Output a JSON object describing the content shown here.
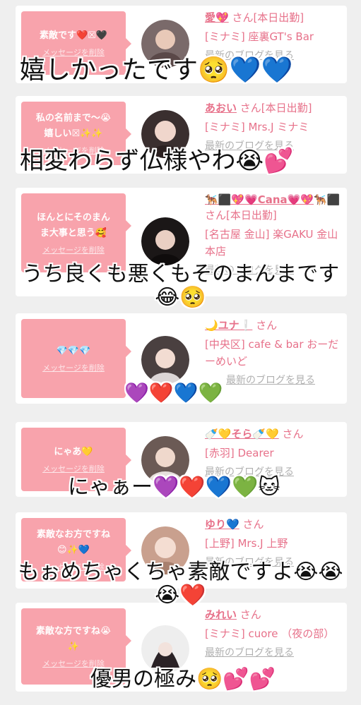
{
  "messages": [
    {
      "bubble": "素敵です❤️☒🖤",
      "delete_label": "メッセージを削除",
      "name": "愛💖",
      "suffix": " さん[本日出勤]",
      "shop": "[ミナミ] 座裏GT's Bar",
      "blog": "最新のブログを見る",
      "avatar_color": "#7a6a6a"
    },
    {
      "bubble": "私の名前まで〜😭\n嬉しい☒✨✨",
      "delete_label": "メッセージを削除",
      "name": "あおい",
      "suffix": " さん[本日出勤]",
      "shop": "[ミナミ] Mrs.J ミナミ",
      "blog": "最新のブログを見る",
      "avatar_color": "#3a2f2f"
    },
    {
      "bubble": "ほんとにそのまん\nま大事と思う🥰",
      "delete_label": "メッセージを削除",
      "name": "🐕‍🦺⬛💖💗Cana💗💖",
      "suffix": "🐕‍🦺⬛ さん[本日出勤]",
      "shop": "[名古屋 金山] 楽GAKU 金山本店",
      "blog": "最新のブログを見る",
      "avatar_color": "#1b1717"
    },
    {
      "bubble": "💎💎💎",
      "delete_label": "メッセージを削除",
      "name": "🌙ユナ❕",
      "suffix": " さん",
      "shop": "[中央区] cafe & bar おーだーめいど",
      "blog": "最新のブログを見る",
      "avatar_color": "#4a4040"
    },
    {
      "bubble": "にゃあ💛",
      "delete_label": "メッセージを削除",
      "name": "🍼💛そら🍼💛",
      "suffix": " さん",
      "shop": "[赤羽] Dearer",
      "blog": "最新のブログを見る",
      "avatar_color": "#6b5a55"
    },
    {
      "bubble": "素敵なお方ですね\n😊✨💙",
      "delete_label": "メッセージを削除",
      "name": "ゆり💙",
      "suffix": " さん",
      "shop": "[上野] Mrs.J 上野",
      "blog": "最新のブログを見る",
      "avatar_color": "#c9a08e"
    },
    {
      "bubble": "素敵な方ですね😭\n✨",
      "delete_label": "メッセージを削除",
      "name": "みれい",
      "suffix": " さん",
      "shop": "[ミナミ] cuore （夜の部）",
      "blog": "最新のブログを見る",
      "avatar_color": "#2a2226"
    }
  ],
  "captions": [
    {
      "text": "嬉しかったです🥺💙💙"
    },
    {
      "text": "相変わらず仏様やわ😭💕"
    },
    {
      "text": "うち良くも悪くもそのまんまです\n😂🥺"
    },
    {
      "text": "💜❤️💙💚"
    },
    {
      "text": "にゃぁー💜❤️💙💚🐱"
    },
    {
      "text": "もぉめちゃくちゃ素敵ですよ😭😭\n😭❤️"
    },
    {
      "text": "優男の極み🥺💕💕"
    }
  ]
}
